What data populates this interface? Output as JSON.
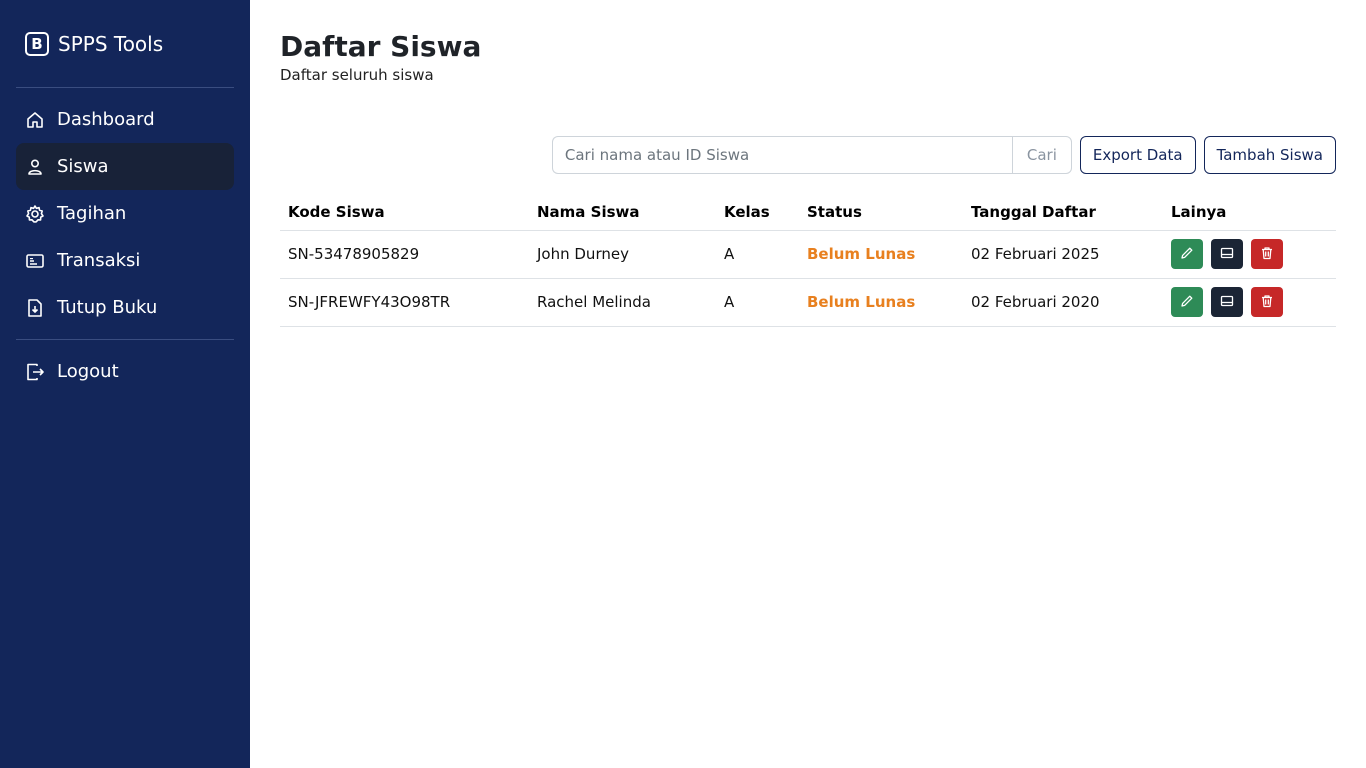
{
  "brand": {
    "icon_letter": "B",
    "name": "SPPS Tools"
  },
  "nav": {
    "items": [
      {
        "label": "Dashboard",
        "icon": "home-icon",
        "active": false
      },
      {
        "label": "Siswa",
        "icon": "user-icon",
        "active": true
      },
      {
        "label": "Tagihan",
        "icon": "gear-icon",
        "active": false
      },
      {
        "label": "Transaksi",
        "icon": "card-icon",
        "active": false
      },
      {
        "label": "Tutup Buku",
        "icon": "file-download-icon",
        "active": false
      }
    ],
    "logout": {
      "label": "Logout",
      "icon": "logout-icon"
    }
  },
  "header": {
    "title": "Daftar Siswa",
    "subtitle": "Daftar seluruh siswa"
  },
  "toolbar": {
    "search_placeholder": "Cari nama atau ID Siswa",
    "search_button": "Cari",
    "export_button": "Export Data",
    "add_button": "Tambah Siswa"
  },
  "table": {
    "columns": [
      "Kode Siswa",
      "Nama Siswa",
      "Kelas",
      "Status",
      "Tanggal Daftar",
      "Lainya"
    ],
    "rows": [
      {
        "kode": "SN-53478905829",
        "nama": "John Durney",
        "kelas": "A",
        "status": "Belum Lunas",
        "tanggal": "02 Februari 2025"
      },
      {
        "kode": "SN-JFREWFY43O98TR",
        "nama": "Rachel Melinda",
        "kelas": "A",
        "status": "Belum Lunas",
        "tanggal": "02 Februari 2020"
      }
    ]
  },
  "colors": {
    "sidebar_bg": "#13265a",
    "active_nav_bg": "#182238",
    "status_unpaid": "#e8801f",
    "edit_btn": "#2e8b57",
    "card_btn": "#1b2535",
    "delete_btn": "#c62828"
  }
}
